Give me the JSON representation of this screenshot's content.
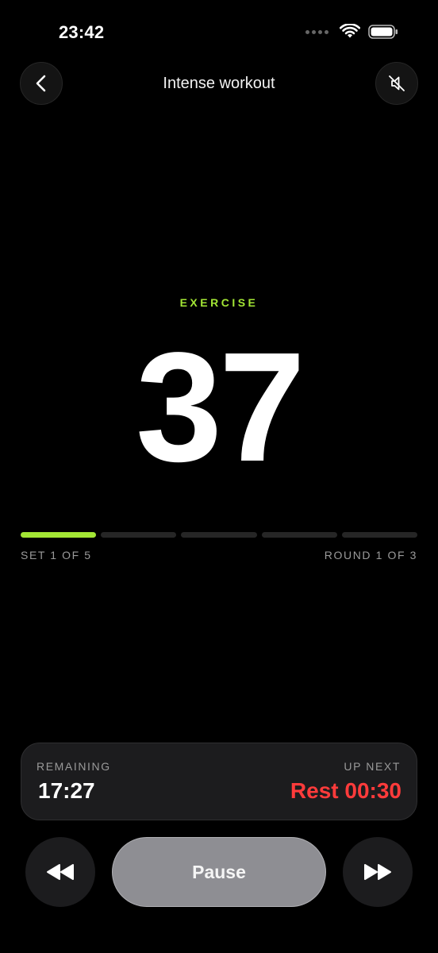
{
  "status_bar": {
    "time": "23:42"
  },
  "nav": {
    "title": "Intense workout"
  },
  "timer": {
    "phase": "EXERCISE",
    "count": "37"
  },
  "progress": {
    "segments_total": 5,
    "segments_done": 1,
    "set_label": "SET 1 OF 5",
    "round_label": "ROUND 1 OF 3"
  },
  "info": {
    "remaining_label": "REMAINING",
    "remaining_value": "17:27",
    "up_next_label": "UP NEXT",
    "up_next_value": "Rest 00:30"
  },
  "controls": {
    "pause_label": "Pause"
  },
  "colors": {
    "accent": "#a3e635",
    "rest": "#ff3b3b",
    "background": "#000000"
  },
  "icons": [
    "back-chevron-icon",
    "speaker-muted-icon",
    "rewind-icon",
    "fast-forward-icon",
    "wifi-icon",
    "battery-icon"
  ]
}
